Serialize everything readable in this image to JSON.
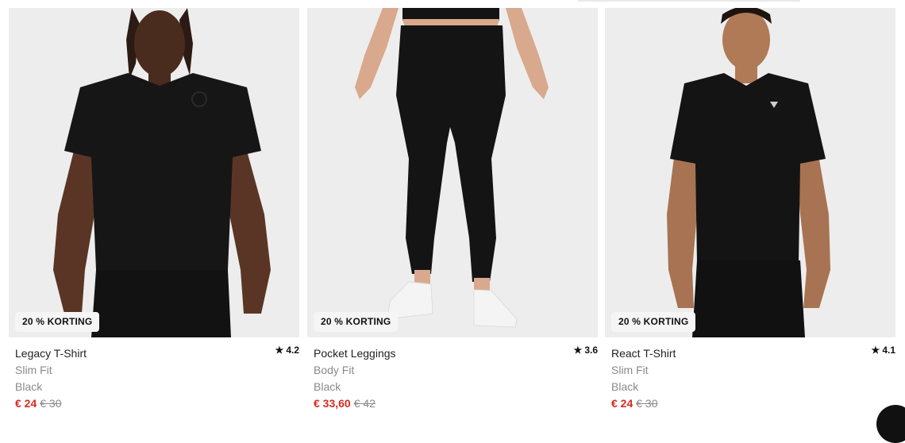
{
  "products": [
    {
      "badge": "20 % KORTING",
      "title": "Legacy T-Shirt",
      "fit": "Slim Fit",
      "color": "Black",
      "price": "€ 24",
      "old_price": "€ 30",
      "rating": "4.2",
      "image_icon": "model-tshirt-photo"
    },
    {
      "badge": "20 % KORTING",
      "title": "Pocket Leggings",
      "fit": "Body Fit",
      "color": "Black",
      "price": "€ 33,60",
      "old_price": "€ 42",
      "rating": "3.6",
      "image_icon": "model-leggings-photo"
    },
    {
      "badge": "20 % KORTING",
      "title": "React T-Shirt",
      "fit": "Slim Fit",
      "color": "Black",
      "price": "€ 24",
      "old_price": "€ 30",
      "rating": "4.1",
      "image_icon": "model-tshirt-photo"
    }
  ],
  "colors": {
    "sale_price": "#d62b1f",
    "image_bg": "#ececec",
    "badge_bg": "#f5f5f5"
  }
}
